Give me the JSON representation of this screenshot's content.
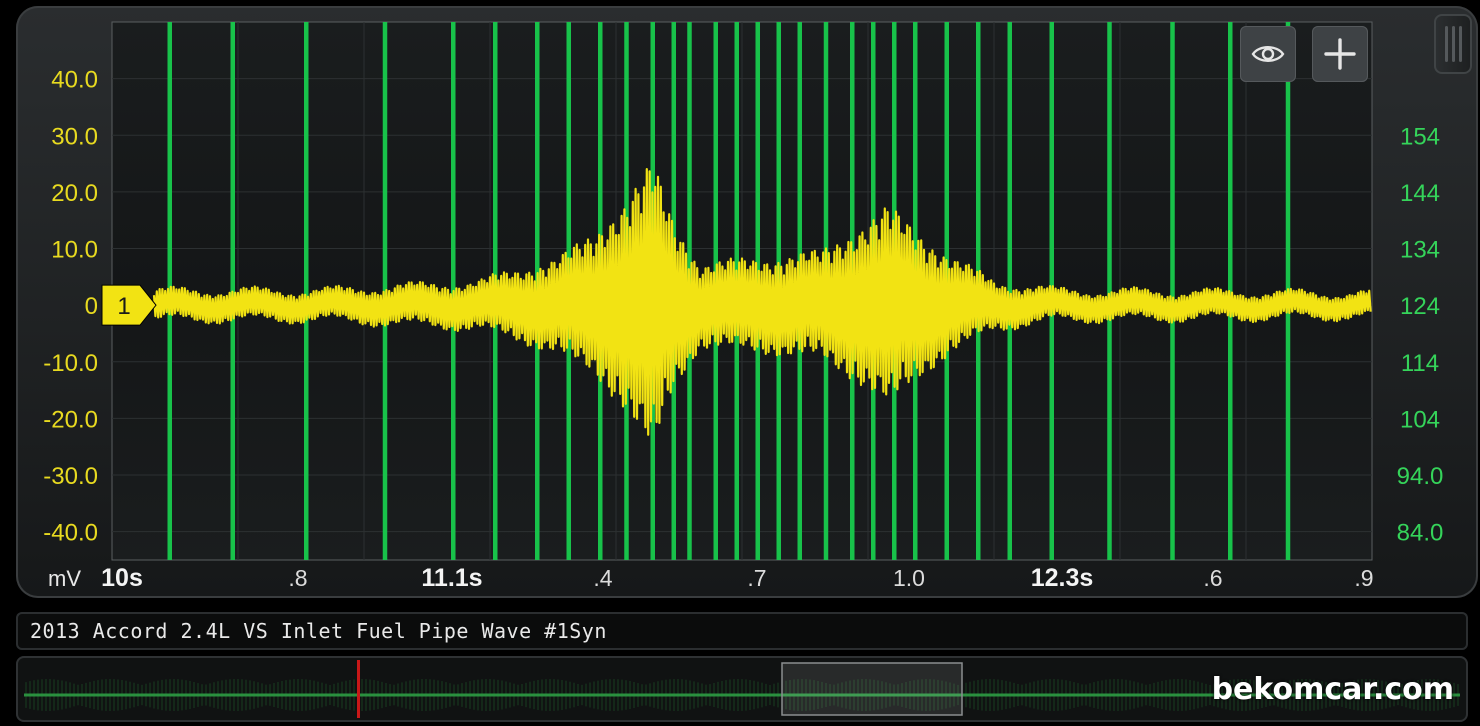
{
  "colors": {
    "trace": "#f2e313",
    "vertical_markers": "#18c24a",
    "left_axis": "#e8da20",
    "right_axis": "#35d45a",
    "background": "#17191a",
    "overview_cursor": "#c81818"
  },
  "icons": {
    "visibility": "eye-icon",
    "add": "plus-icon",
    "channel_marker": "flag-icon"
  },
  "caption": {
    "title": "2013 Accord 2.4L VS Inlet Fuel Pipe Wave #1Syn"
  },
  "watermark": "bekomcar.com",
  "chart_data": {
    "type": "line",
    "left_axis": {
      "unit": "mV",
      "ticks": [
        "40.0",
        "30.0",
        "20.0",
        "10.0",
        "0",
        "-10.0",
        "-20.0",
        "-30.0",
        "-40.0"
      ],
      "range": [
        -45,
        50
      ]
    },
    "right_axis": {
      "ticks": [
        "154",
        "144",
        "134",
        "124",
        "114",
        "104",
        "94.0",
        "84.0"
      ]
    },
    "x_axis": {
      "ticks": [
        {
          "label": "10s",
          "bold": true
        },
        {
          "label": ".8",
          "bold": false
        },
        {
          "label": "11.1s",
          "bold": true
        },
        {
          "label": ".4",
          "bold": false
        },
        {
          "label": ".7",
          "bold": false
        },
        {
          "label": "1.0",
          "bold": false
        },
        {
          "label": "12.3s",
          "bold": true
        },
        {
          "label": ".6",
          "bold": false
        },
        {
          "label": ".9",
          "bold": false
        }
      ],
      "range": [
        10.5,
        12.9
      ]
    },
    "channel_marker": {
      "label": "1",
      "value": 0
    },
    "vertical_markers_x": [
      10.61,
      10.73,
      10.87,
      11.02,
      11.15,
      11.23,
      11.31,
      11.37,
      11.43,
      11.48,
      11.53,
      11.57,
      11.6,
      11.65,
      11.69,
      11.73,
      11.77,
      11.81,
      11.86,
      11.91,
      11.95,
      11.99,
      12.03,
      12.09,
      12.15,
      12.21,
      12.29,
      12.4,
      12.52,
      12.63,
      12.74
    ],
    "envelope": [
      {
        "x": 10.6,
        "amp": 2.5
      },
      {
        "x": 10.9,
        "amp": 2.5
      },
      {
        "x": 11.2,
        "amp": 4
      },
      {
        "x": 11.35,
        "amp": 8
      },
      {
        "x": 11.42,
        "amp": 12
      },
      {
        "x": 11.48,
        "amp": 18
      },
      {
        "x": 11.53,
        "amp": 25
      },
      {
        "x": 11.57,
        "amp": 14
      },
      {
        "x": 11.62,
        "amp": 7
      },
      {
        "x": 11.75,
        "amp": 8
      },
      {
        "x": 11.85,
        "amp": 9
      },
      {
        "x": 11.92,
        "amp": 13
      },
      {
        "x": 11.98,
        "amp": 17
      },
      {
        "x": 12.04,
        "amp": 12
      },
      {
        "x": 12.1,
        "amp": 8
      },
      {
        "x": 12.18,
        "amp": 4
      },
      {
        "x": 12.3,
        "amp": 2.5
      },
      {
        "x": 12.9,
        "amp": 2
      }
    ]
  }
}
